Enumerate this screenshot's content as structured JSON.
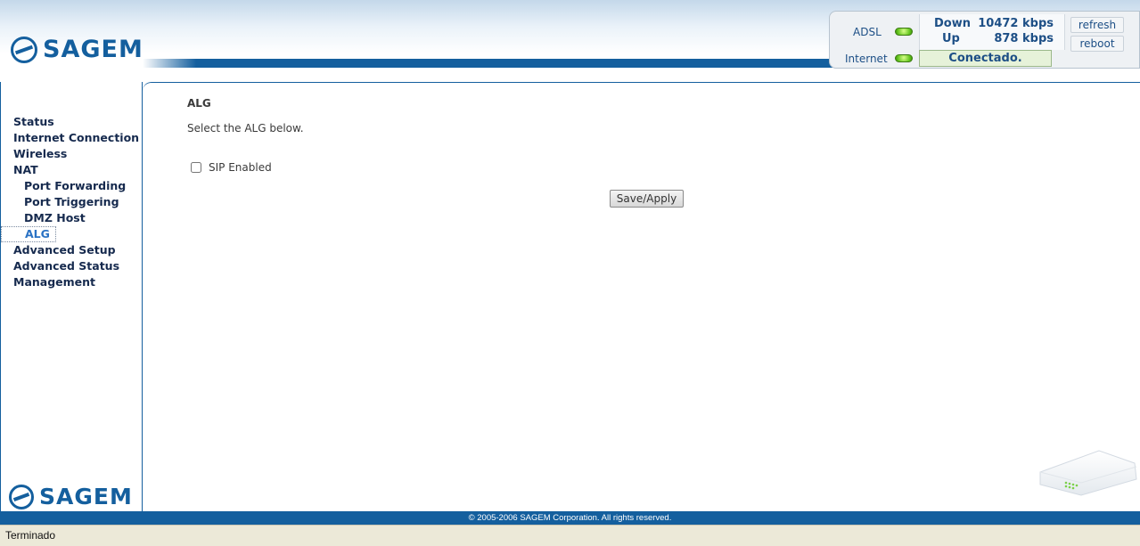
{
  "brand": {
    "logo_text": "SAGEM"
  },
  "status": {
    "adsl_label": "ADSL",
    "internet_label": "Internet",
    "down_label": "Down",
    "up_label": "Up",
    "down_speed": "10472 kbps",
    "up_speed": "878 kbps",
    "connection_status": "Conectado.",
    "refresh_label": "refresh",
    "reboot_label": "reboot",
    "led_color": "#5fc21a"
  },
  "sidebar": {
    "items": [
      {
        "label": "Status"
      },
      {
        "label": "Internet Connection"
      },
      {
        "label": "Wireless"
      },
      {
        "label": "NAT"
      },
      {
        "label": "Port Forwarding"
      },
      {
        "label": "Port Triggering"
      },
      {
        "label": "DMZ Host"
      },
      {
        "label": "ALG"
      },
      {
        "label": "Advanced Setup"
      },
      {
        "label": "Advanced Status"
      },
      {
        "label": "Management"
      }
    ]
  },
  "main": {
    "title": "ALG",
    "description": "Select the ALG below.",
    "sip_label": "SIP Enabled",
    "sip_checked": false,
    "save_label": "Save/Apply"
  },
  "footer": {
    "copyright": "© 2005-2006 SAGEM Corporation. All rights reserved."
  },
  "browser": {
    "status_text": "Terminado"
  },
  "colors": {
    "brand_blue": "#145f9e",
    "nav_text": "#162a4e",
    "nav_active": "#2a72c4"
  }
}
